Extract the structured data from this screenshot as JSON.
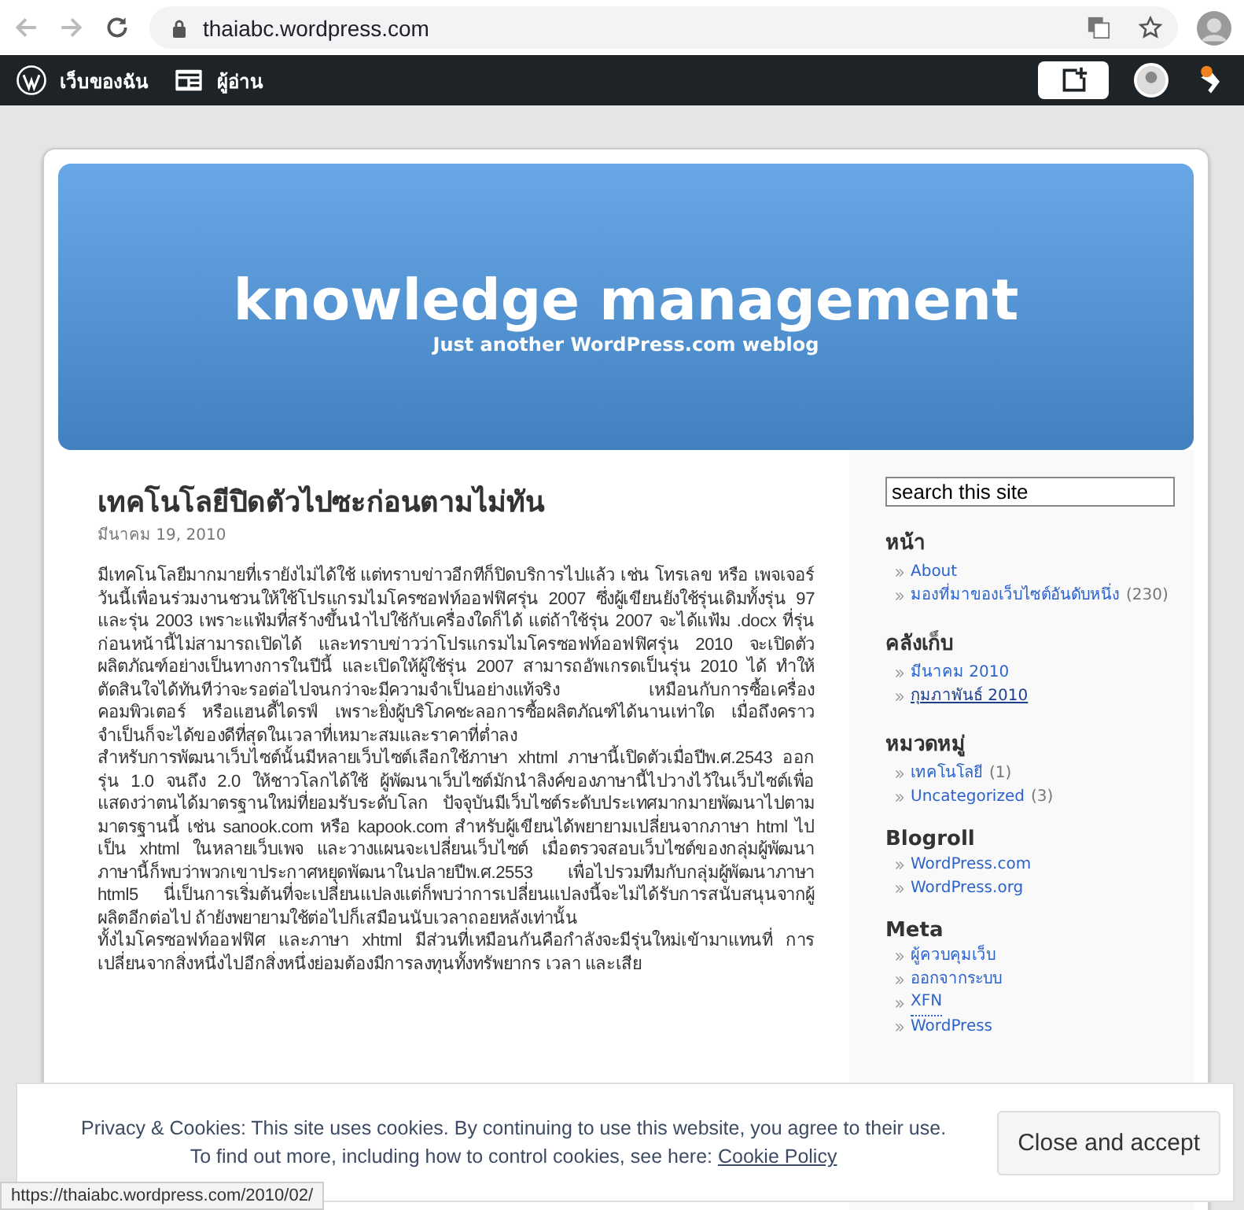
{
  "browser": {
    "url": "thaiabc.wordpress.com",
    "status_url": "https://thaiabc.wordpress.com/2010/02/"
  },
  "admin_bar": {
    "items": [
      {
        "kind": "wordpress",
        "label": "เว็บของฉัน"
      },
      {
        "kind": "reader",
        "label": "ผู้อ่าน"
      }
    ]
  },
  "header": {
    "title": "knowledge management",
    "tagline": "Just another WordPress.com weblog"
  },
  "post": {
    "title": "เทคโนโลยีปิดตัวไปซะก่อนตามไม่ทัน",
    "date": "มีนาคม 19, 2010",
    "paragraphs": [
      "มีเทคโนโลยีมากมายที่เรายังไม่ได้ใช้ แต่ทราบข่าวอีกทีก็ปิดบริการไปแล้ว เช่น โทรเลข หรือ เพจเจอร์ วันนี้เพื่อนร่วมงานชวนให้ใช้โปรแกรมไมโครซอฟท์ออฟฟิศรุ่น 2007 ซึ่งผู้เขียนยังใช้รุ่นเดิมทั้งรุ่น 97 และรุ่น 2003 เพราะแฟ้มที่สร้างขึ้นนำไปใช้กับเครื่องใดก็ได้ แต่ถ้าใช้รุ่น 2007 จะได้แฟ้ม .docx ที่รุ่นก่อนหน้านี้ไม่สามารถเปิดได้ และทราบข่าวว่าโปรแกรมไมโครซอฟท์ออฟฟิศรุ่น 2010 จะเปิดตัวผลิตภัณฑ์อย่างเป็นทางการในปีนี้ และเปิดให้ผู้ใช้รุ่น 2007 สามารถอัพเกรดเป็นรุ่น 2010 ได้ ทำให้ตัดสินใจได้ทันทีว่าจะรอต่อไปจนกว่าจะมีความจำเป็นอย่างแท้จริง เหมือนกับการซื้อเครื่องคอมพิวเตอร์ หรือแฮนดี้ไดรฟ์ เพราะยิ่งผู้บริโภคชะลอการซื้อผลิตภัณฑ์ได้นานเท่าใด เมื่อถึงคราวจำเป็นก็จะได้ของดีที่สุดในเวลาที่เหมาะสมและราคาที่ต่ำลง",
      "สำหรับการพัฒนาเว็บไซต์นั้นมีหลายเว็บไซต์เลือกใช้ภาษา xhtml ภาษานี้เปิดตัวเมื่อปีพ.ศ.2543 ออกรุ่น 1.0 จนถึง 2.0 ให้ชาวโลกได้ใช้ ผู้พัฒนาเว็บไซต์มักนำลิงค์ของภาษานี้ไปวางไว้ในเว็บไซต์เพื่อแสดงว่าตนได้มาตรฐานใหม่ที่ยอมรับระดับโลก ปัจจุบันมีเว็บไซต์ระดับประเทศมากมายพัฒนาไปตามมาตรฐานนี้ เช่น sanook.com หรือ kapook.com สำหรับผู้เขียนได้พยายามเปลี่ยนจากภาษา html ไปเป็น xhtml ในหลายเว็บเพจ และวางแผนจะเปลี่ยนเว็บไซต์ เมื่อตรวจสอบเว็บไซต์ของกลุ่มผู้พัฒนาภาษานี้ก็พบว่าพวกเขาประกาศหยุดพัฒนาในปลายปีพ.ศ.2553 เพื่อไปรวมทีมกับกลุ่มผู้พัฒนาภาษา html5 นี่เป็นการเริ่มต้นที่จะเปลี่ยนแปลงแต่ก็พบว่าการเปลี่ยนแปลงนี้จะไม่ได้รับการสนับสนุนจากผู้ผลิตอีกต่อไป ถ้ายังพยายามใช้ต่อไปก็เสมือนนับเวลาถอยหลังเท่านั้น",
      "ทั้งไมโครซอฟท์ออฟฟิศ และภาษา xhtml มีส่วนที่เหมือนกันคือกำลังจะมีรุ่นใหม่เข้ามาแทนที่ การเปลี่ยนจากสิ่งหนึ่งไปอีกสิ่งหนึ่งย่อมต้องมีการลงทุนทั้งทรัพยากร เวลา และเสีย"
    ]
  },
  "sidebar": {
    "search": {
      "placeholder": "search this site"
    },
    "sections": [
      {
        "title": "หน้า",
        "items": [
          {
            "label": "About",
            "hovered": false
          },
          {
            "label": "มองที่มาของเว็บไซต์อันดับหนึ่ง",
            "count": "(230)",
            "hovered": false
          }
        ]
      },
      {
        "title": "คลังเก็บ",
        "items": [
          {
            "label": "มีนาคม 2010",
            "hovered": false
          },
          {
            "label": "กุมภาพันธ์ 2010",
            "hovered": true
          }
        ]
      },
      {
        "title": "หมวดหมู่",
        "items": [
          {
            "label": "เทคโนโลยี",
            "count": "(1)",
            "hovered": false
          },
          {
            "label": "Uncategorized",
            "count": "(3)",
            "hovered": false
          }
        ]
      },
      {
        "title": "Blogroll",
        "items": [
          {
            "label": "WordPress.com",
            "hovered": false
          },
          {
            "label": "WordPress.org",
            "hovered": false
          }
        ]
      },
      {
        "title": "Meta",
        "items": [
          {
            "label": "ผู้ควบคุมเว็บ",
            "hovered": false
          },
          {
            "label": "ออกจากระบบ",
            "hovered": false
          },
          {
            "label": "XFN",
            "hovered": false,
            "abbr": true
          },
          {
            "label": "WordPress",
            "hovered": false
          }
        ]
      }
    ]
  },
  "cookie_banner": {
    "text": "Privacy & Cookies: This site uses cookies. By continuing to use this website, you agree to their use.",
    "more": "To find out more, including how to control cookies, see here:",
    "link": "Cookie Policy",
    "button": "Close and accept"
  }
}
